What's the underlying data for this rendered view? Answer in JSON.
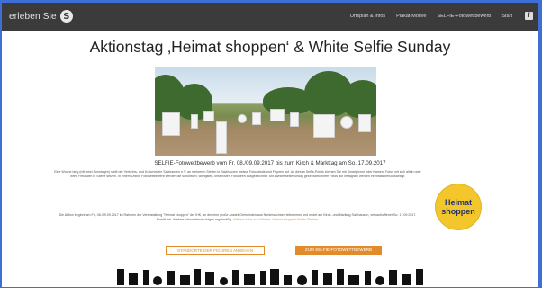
{
  "header": {
    "brand_text": "erleben Sie",
    "logo_letter": "S",
    "nav": [
      {
        "label": "Ortsplan & Infos"
      },
      {
        "label": "Plakat-Motive"
      },
      {
        "label": "SELFIE-Fotowettbewerb"
      },
      {
        "label": "Start"
      }
    ],
    "facebook_glyph": "f"
  },
  "main": {
    "title": "Aktionstag ‚Heimat shoppen‘ & White Selfie Sunday",
    "subheading": "SELFIE-Fotowettbewerb vom Fr. 08./09.09.2017 bis zum Kirch & Markttag am So. 17.09.2017",
    "paragraph1": "Eine Woche lang (mit zwei Sonntagen) stellt der Verkehrs- und Kulturverein Salzhausen e.V. an mehreren Stellen in Salzhausen weisse Fotowände und Figuren auf. An diesen Selfie-Points können Sie mit Smartphone oder Kamera Fotos mit sich allein oder Ihren Freunden in Szene setzen. In einem Online Fotowettbewerb werden die schönsten, witzigsten, kreativsten Fotoideen ausgezeichnet. Mit #whitesselfiesunday gekennzeichnete Fotos auf Instagram werden ebenfalls berücksichtigt.",
    "paragraph2_text": "Die Aktion beginnt am Fr., 08./09.09.2017 im Rahmen der Veranstaltung \"Heimat shoppen\" der IHK, an der eine große Anzahl Gemeinden aus Niedersachsen teilnehmen und endet am Kirch- und Marktag Salzhausen, verkaufsoffener So. 17.09.2017. Eintritt frei. Weitere Informationen folgen regelmäßig.",
    "paragraph2_link": "Weitere Infos zur Initiative .Heimat shoppen' finden Sie hier.",
    "badge_line1": "Heimat",
    "badge_line2": "shoppen",
    "button_locations": "STANDORTE DER FIGUREN ANSEHEN",
    "button_contest": "ZUM SELFIE-FOTOWETTBEWERB"
  },
  "colors": {
    "accent": "#e38b2b",
    "nav_bg": "#3b3b3b",
    "badge": "#f3c62b",
    "badge_text": "#23336a",
    "outer_border": "#3d6fd4"
  }
}
